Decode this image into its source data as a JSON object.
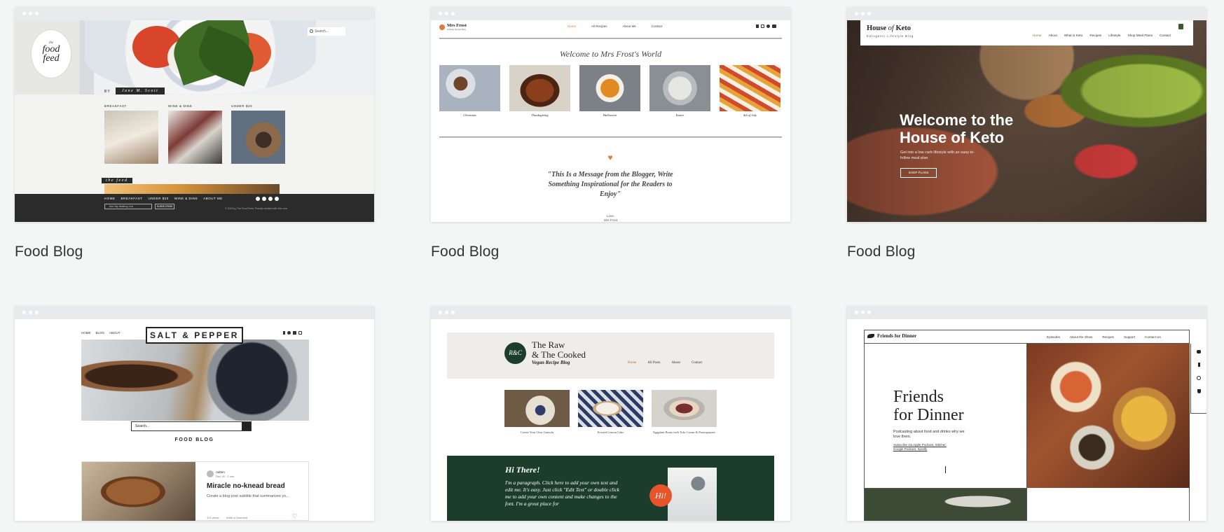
{
  "cards": [
    {
      "title": "Food Blog",
      "logo_line1": "the",
      "logo_line2": "food",
      "logo_line3": "feed",
      "search": "Search...",
      "byline_prefix": "BY",
      "author": "Jane M. Scott",
      "categories": [
        "BREAKFAST",
        "WINE & DINE",
        "UNDER $20"
      ],
      "banner": "the feed",
      "nav": [
        "HOME",
        "BREAKFAST",
        "UNDER $20",
        "WINE & DINE",
        "ABOUT ME"
      ],
      "mailing_placeholder": "Join My Mailing List",
      "subscribe": "SUBSCRIBE",
      "copyright": "© 2023 by The Food Feed. Proudly created with Wix.com"
    },
    {
      "title": "Food Blog",
      "logo": "Mrs Frost",
      "logo_sub": "Holiday Recipe Blog",
      "nav": [
        "Home",
        "All Recipes",
        "About Me",
        "Contact"
      ],
      "welcome": "Welcome to Mrs Frost's World",
      "items": [
        "Christmas",
        "Thanksgiving",
        "Halloween",
        "Easter",
        "4th of July"
      ],
      "quote": "\"This Is a Message from the Blogger, Write Something Inspirational for the Readers to Enjoy\"",
      "signoff_1": "Love,",
      "signoff_2": "Mrs Frost"
    },
    {
      "title": "Food Blog",
      "logo_a": "House",
      "logo_b": "of",
      "logo_c": "Keto",
      "tagline": "Ketogenic Lifestyle Blog",
      "nav": [
        "Home",
        "About",
        "What is Keto",
        "Recipes",
        "Lifestyle",
        "Shop Meal Plans",
        "Contact"
      ],
      "headline": "Welcome to the House of Keto",
      "sub": "Get into a low carb lifestyle with an easy-to-follow meal plan",
      "cta": "SHOP PLANS"
    },
    {
      "title": "Food Blog",
      "nav": [
        "HOME",
        "BLOG",
        "ABOUT"
      ],
      "logo": "SALT & PEPPER",
      "search": "Search...",
      "section": "FOOD BLOG",
      "author": "Admin",
      "date": "Dec 15  ·  2 min",
      "post_title": "Miracle no-knead bread",
      "post_sub": "Create a blog post subtitle that summarizes yo...",
      "views": "113 views",
      "comment": "Write a comment"
    },
    {
      "title": "Food Blog",
      "monogram": "R&C",
      "logo_1": "The Raw",
      "logo_2": "& The Cooked",
      "logo_sub": "Vegan Recipe Blog",
      "nav": [
        "Home",
        "All Posts",
        "About",
        "Contact"
      ],
      "items": [
        "Create Your Own Granola",
        "Frosted Lemon Cake",
        "Eggplant Boats with Tofu Cream & Pomegranate"
      ],
      "hi": "Hi There!",
      "para": "I'm a paragraph. Click here to add your own text and edit me. It's easy. Just click \"Edit Text\" or double click me to add your own content and make changes to the font. I'm a great place for",
      "badge": "Hi!"
    },
    {
      "title": "Food Blog",
      "logo": "Friends for Dinner",
      "nav": [
        "Episodes",
        "About the Show",
        "Recipes",
        "Support",
        "Contact Us"
      ],
      "headline_1": "Friends",
      "headline_2": "for Dinner",
      "sub": "Podcasting about food and drinks why we love them.",
      "subscribe_1": "Subscribe via Apple Podcast, Stitcher,",
      "subscribe_2": "Google Podcast, Spotify"
    }
  ],
  "colors": {
    "page_bg": "#f4f5f5",
    "chrome": "#e9eaee",
    "keto_overlay": "#3a2e24",
    "raw_green": "#1d3d2c",
    "hi_orange": "#e8542a",
    "frost_heart": "#e07b39"
  }
}
